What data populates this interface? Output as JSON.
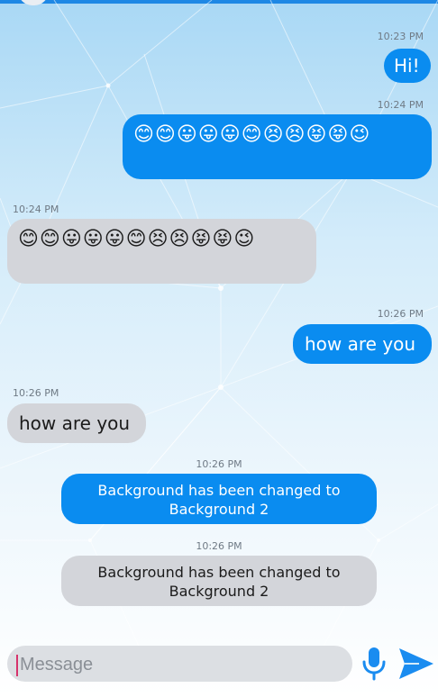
{
  "messages": [
    {
      "time": "10:23 PM",
      "text": "Hi!",
      "direction": "out"
    },
    {
      "time": "10:24 PM",
      "text": "😊😊😛😛😛😊😣😣😝😝😉",
      "direction": "out"
    },
    {
      "time": "10:24 PM",
      "text": "😊😊😛😛😛😊😣😣😝😝😉",
      "direction": "in"
    },
    {
      "time": "10:26 PM",
      "text": "how are you",
      "direction": "out"
    },
    {
      "time": "10:26 PM",
      "text": "how are you",
      "direction": "in"
    },
    {
      "time": "10:26 PM",
      "text": "Background has been changed to Background 2",
      "direction": "out"
    },
    {
      "time": "10:26 PM",
      "text": "Background has been changed to Background 2",
      "direction": "in"
    }
  ],
  "composer": {
    "placeholder": "Message",
    "value": ""
  },
  "icons": {
    "mic": "microphone-icon",
    "send": "send-icon"
  },
  "colors": {
    "accent": "#0a8cf0",
    "incoming_bubble": "#d3d5da",
    "outgoing_bubble": "#0a8cf0"
  }
}
